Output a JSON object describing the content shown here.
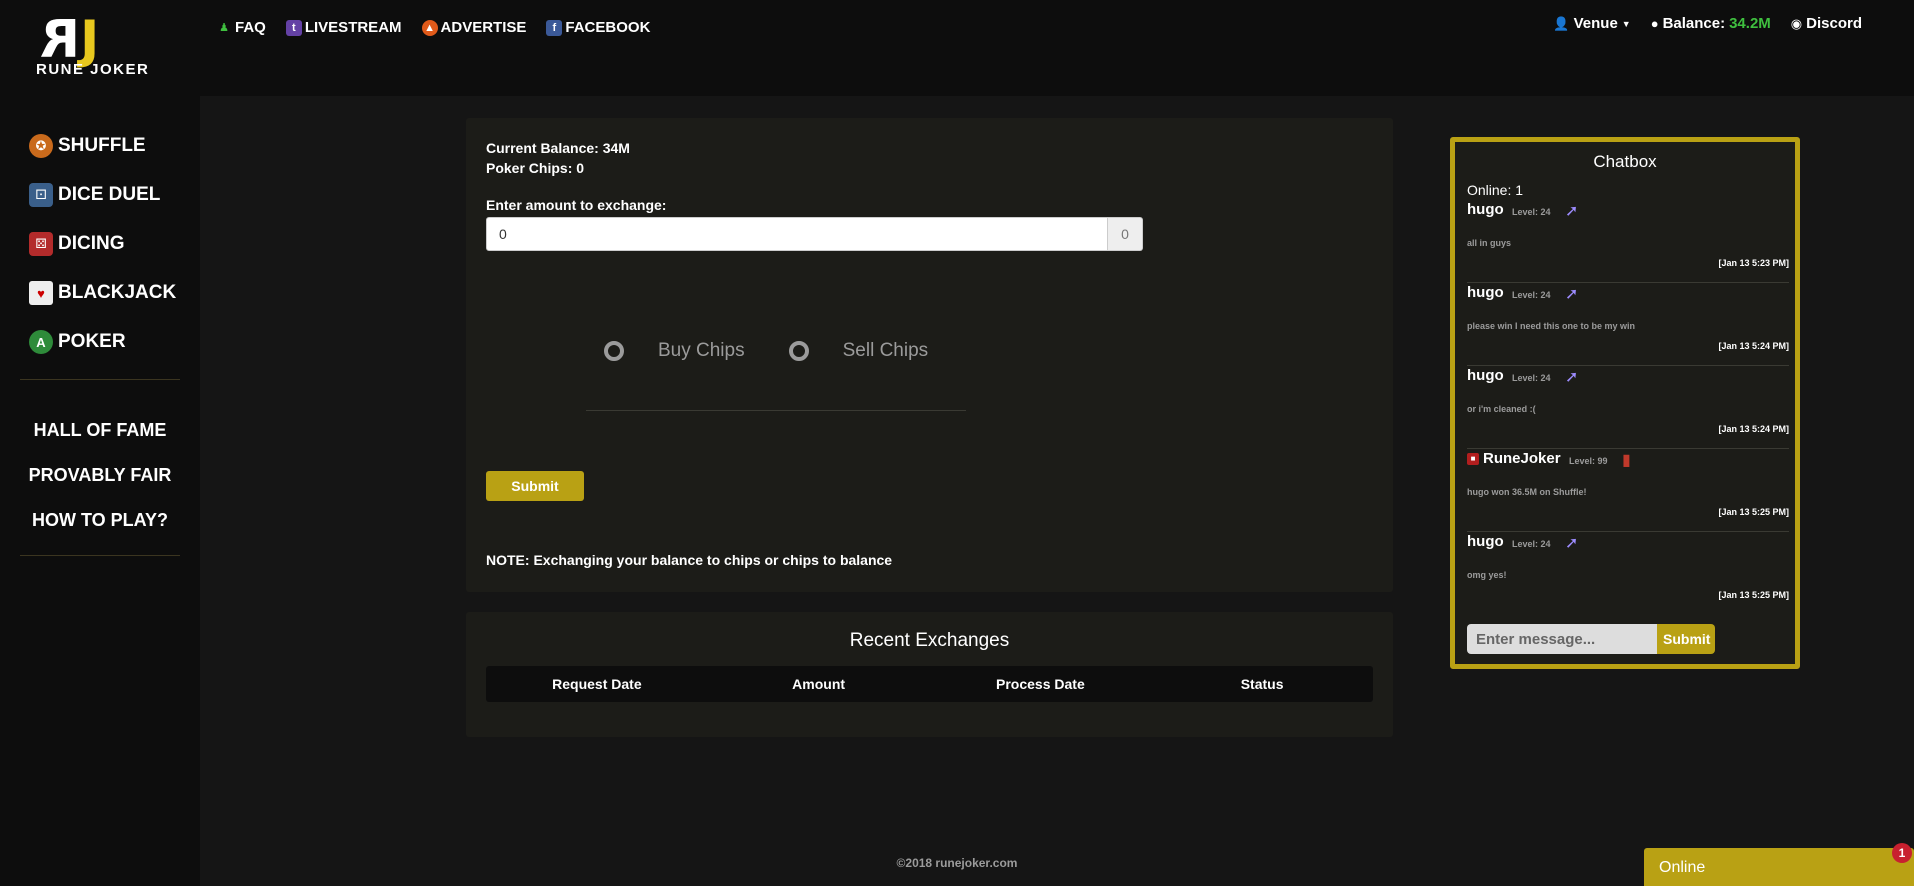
{
  "brand": {
    "logo_text": "RUNE JOKER",
    "logo_mark_left": "R",
    "logo_mark_right": "J",
    "accent": "#b9a114"
  },
  "topnav": [
    {
      "label": "FAQ",
      "icon": "people-icon"
    },
    {
      "label": "LIVESTREAM",
      "icon": "twitch-icon"
    },
    {
      "label": "ADVERTISE",
      "icon": "megaphone-icon"
    },
    {
      "label": "FACEBOOK",
      "icon": "facebook-icon"
    }
  ],
  "account": {
    "user": "Venue",
    "balance_label": "Balance:",
    "balance_value": "34.2M",
    "discord": "Discord"
  },
  "sidebar": {
    "games": [
      {
        "label": "SHUFFLE",
        "icon": "shuffle-icon"
      },
      {
        "label": "DICE DUEL",
        "icon": "dice-duel-icon"
      },
      {
        "label": "DICING",
        "icon": "dice-icon"
      },
      {
        "label": "BLACKJACK",
        "icon": "cards-icon"
      },
      {
        "label": "POKER",
        "icon": "poker-icon"
      }
    ],
    "links": [
      "HALL OF FAME",
      "PROVABLY FAIR",
      "HOW TO PLAY?"
    ]
  },
  "exchange": {
    "current_balance": "Current Balance: 34M",
    "poker_chips": "Poker Chips: 0",
    "enter_label": "Enter amount to exchange:",
    "amount_value": "0",
    "amount_addon": "0",
    "buy_label": "Buy Chips",
    "sell_label": "Sell Chips",
    "submit_label": "Submit",
    "note": "NOTE: Exchanging your balance to chips or chips to balance"
  },
  "recent": {
    "title": "Recent Exchanges",
    "columns": [
      "Request Date",
      "Amount",
      "Process Date",
      "Status"
    ]
  },
  "chat": {
    "title": "Chatbox",
    "online": "Online: 1",
    "messages": [
      {
        "user": "hugo",
        "level": "Level: 24",
        "text": "all in guys",
        "time": "[Jan 13 5:23 PM]"
      },
      {
        "user": "hugo",
        "level": "Level: 24",
        "text": "please win I need this one to be my win",
        "time": "[Jan 13 5:24 PM]"
      },
      {
        "user": "hugo",
        "level": "Level: 24",
        "text": "or i'm cleaned :(",
        "time": "[Jan 13 5:24 PM]"
      },
      {
        "user": "RuneJoker",
        "level": "Level: 99",
        "text": "hugo won 36.5M on Shuffle!",
        "time": "[Jan 13 5:25 PM]"
      },
      {
        "user": "hugo",
        "level": "Level: 24",
        "text": "omg yes!",
        "time": "[Jan 13 5:25 PM]"
      }
    ],
    "input_placeholder": "Enter message...",
    "submit_label": "Submit"
  },
  "footer": "©2018 runejoker.com",
  "online_widget": {
    "label": "Online",
    "badge": "1"
  }
}
